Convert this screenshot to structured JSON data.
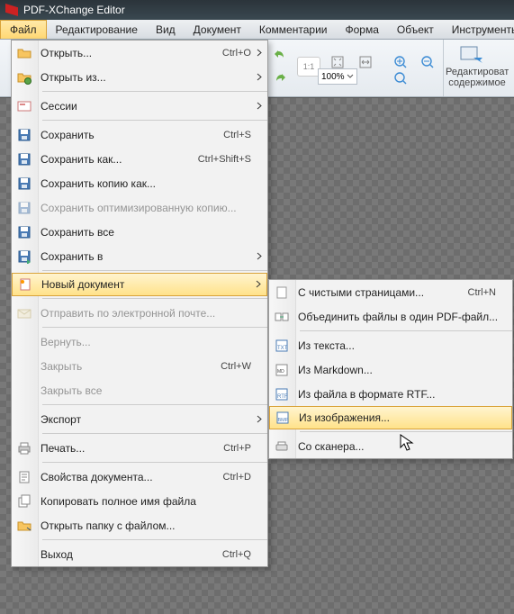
{
  "app": {
    "title": "PDF-XChange Editor"
  },
  "menubar": {
    "items": [
      "Файл",
      "Редактирование",
      "Вид",
      "Документ",
      "Комментарии",
      "Форма",
      "Объект",
      "Инструменты"
    ],
    "selected": 0
  },
  "toolbar": {
    "zoom_value": "100%",
    "edit_contents_line1": "Редактироват",
    "edit_contents_line2": "содержимое"
  },
  "fileMenu": [
    {
      "label": "Открыть...",
      "shortcut": "Ctrl+O",
      "arrow": true,
      "icon": "folder-open"
    },
    {
      "label": "Открыть из...",
      "arrow": true,
      "icon": "folder-globe"
    },
    {
      "sep": true
    },
    {
      "label": "Сессии",
      "arrow": true,
      "icon": "sessions"
    },
    {
      "sep": true
    },
    {
      "label": "Сохранить",
      "shortcut": "Ctrl+S",
      "icon": "save"
    },
    {
      "label": "Сохранить как...",
      "shortcut": "Ctrl+Shift+S",
      "icon": "save-as"
    },
    {
      "label": "Сохранить копию как...",
      "icon": "save-copy"
    },
    {
      "label": "Сохранить оптимизированную копию...",
      "icon": "save-opt",
      "disabled": true
    },
    {
      "label": "Сохранить все",
      "icon": "save-all"
    },
    {
      "label": "Сохранить в",
      "arrow": true,
      "icon": "save-to"
    },
    {
      "sep": true
    },
    {
      "label": "Новый документ",
      "arrow": true,
      "icon": "new-doc",
      "highlight": true
    },
    {
      "sep": true
    },
    {
      "label": "Отправить по электронной почте...",
      "icon": "mail",
      "disabled": true
    },
    {
      "sep": true
    },
    {
      "label": "Вернуть...",
      "disabled": true
    },
    {
      "label": "Закрыть",
      "shortcut": "Ctrl+W",
      "disabled": true
    },
    {
      "label": "Закрыть все",
      "disabled": true
    },
    {
      "sep": true
    },
    {
      "label": "Экспорт",
      "arrow": true
    },
    {
      "sep": true
    },
    {
      "label": "Печать...",
      "shortcut": "Ctrl+P",
      "icon": "print"
    },
    {
      "sep": true
    },
    {
      "label": "Свойства документа...",
      "shortcut": "Ctrl+D",
      "icon": "doc-props"
    },
    {
      "label": "Копировать полное имя файла",
      "icon": "copy-name"
    },
    {
      "label": "Открыть папку с файлом...",
      "icon": "open-folder"
    },
    {
      "sep": true
    },
    {
      "label": "Выход",
      "shortcut": "Ctrl+Q"
    }
  ],
  "submenu": [
    {
      "label": "С чистыми страницами...",
      "shortcut": "Ctrl+N",
      "icon": "blank-page"
    },
    {
      "label": "Объединить файлы в один PDF-файл...",
      "icon": "combine"
    },
    {
      "sep": true
    },
    {
      "label": "Из текста...",
      "icon": "from-txt"
    },
    {
      "label": "Из Markdown...",
      "icon": "from-md"
    },
    {
      "label": "Из файла в формате RTF...",
      "icon": "from-rtf"
    },
    {
      "label": "Из изображения...",
      "icon": "from-img",
      "highlight": true
    },
    {
      "sep": true
    },
    {
      "label": "Со сканера...",
      "icon": "from-scanner"
    }
  ]
}
